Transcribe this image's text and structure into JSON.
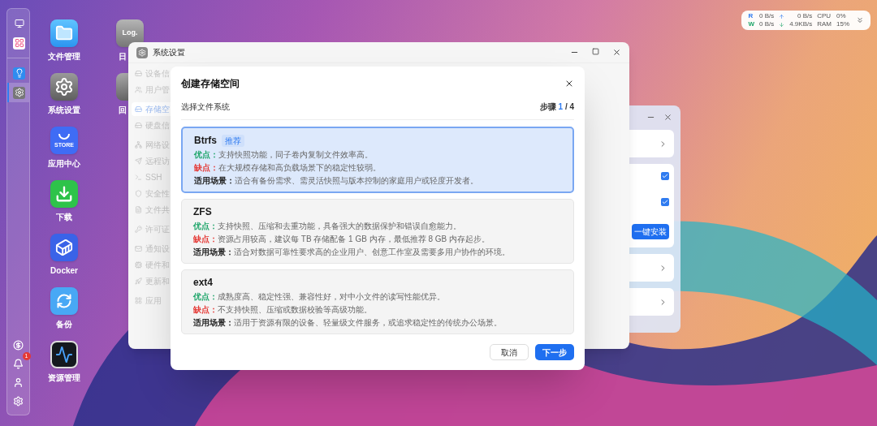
{
  "status_widget": {
    "rows": [
      {
        "label": "R",
        "disk": "0 B/s",
        "kind": "upload",
        "net": "0 B/s",
        "metric": "CPU",
        "value": "0%"
      },
      {
        "label": "W",
        "disk": "0 B/s",
        "kind": "download",
        "net": "4.9KB/s",
        "metric": "RAM",
        "value": "15%"
      }
    ]
  },
  "dock": {
    "items": [
      {
        "kind": "monitor",
        "selected": false
      },
      {
        "kind": "apps",
        "selected": false
      },
      {
        "kind": "bulb",
        "selected": false
      },
      {
        "kind": "settings",
        "selected": true
      }
    ],
    "bottom": [
      {
        "kind": "coin"
      },
      {
        "kind": "bell",
        "badge": "1"
      },
      {
        "kind": "user"
      },
      {
        "kind": "gear"
      }
    ]
  },
  "desktop_icons": [
    {
      "kind": "folder",
      "label": "文件管理"
    },
    {
      "kind": "settings",
      "label": "系统设置"
    },
    {
      "kind": "store",
      "label": "应用中心",
      "icon_text": "STORE"
    },
    {
      "kind": "download",
      "label": "下载"
    },
    {
      "kind": "docker",
      "label": "Docker"
    },
    {
      "kind": "backup",
      "label": "备份"
    },
    {
      "kind": "monitor",
      "label": "资源管理"
    }
  ],
  "desktop_icons_2": [
    {
      "kind": "log",
      "label": "日",
      "icon_text": "Log."
    },
    {
      "kind": "trash",
      "label": "回"
    }
  ],
  "settings_window": {
    "title": "系统设置",
    "sidebar_groups": [
      [
        {
          "label": "设备信",
          "selected": false
        },
        {
          "label": "用户管",
          "selected": false
        }
      ],
      [
        {
          "label": "存储空",
          "selected": true
        },
        {
          "label": "硬盘信",
          "selected": false
        }
      ],
      [
        {
          "label": "网络设",
          "selected": false
        },
        {
          "label": "远程访",
          "selected": false
        },
        {
          "label": "SSH",
          "selected": false
        },
        {
          "label": "安全性",
          "selected": false
        },
        {
          "label": "文件共",
          "selected": false
        }
      ],
      [
        {
          "label": "许可证",
          "selected": false
        }
      ],
      [
        {
          "label": "通知设",
          "selected": false
        },
        {
          "label": "硬件和",
          "selected": false
        },
        {
          "label": "更新和",
          "selected": false
        }
      ],
      [
        {
          "label": "应用",
          "selected": false
        }
      ]
    ]
  },
  "dialog": {
    "title": "创建存储空间",
    "subtitle": "选择文件系统",
    "step_label": "步骤",
    "step_current": "1",
    "step_total": "/ 4",
    "options": [
      {
        "name": "Btrfs",
        "badge": "推荐",
        "selected": true,
        "pros_label": "优点：",
        "pros": "支持快照功能，同子卷内复制文件效率高。",
        "cons_label": "缺点：",
        "cons": "在大规模存储和高负载场景下的稳定性较弱。",
        "use_label": "适用场景：",
        "use": "适合有备份需求、需灵活快照与版本控制的家庭用户或轻度开发者。"
      },
      {
        "name": "ZFS",
        "selected": false,
        "pros_label": "优点：",
        "pros": "支持快照、压缩和去重功能，具备强大的数据保护和错误自愈能力。",
        "cons_label": "缺点：",
        "cons": "资源占用较高，建议每 TB 存储配备 1 GB 内存，最低推荐 8 GB 内存起步。",
        "use_label": "适用场景：",
        "use": "适合对数据可靠性要求高的企业用户、创意工作室及需要多用户协作的环境。"
      },
      {
        "name": "ext4",
        "selected": false,
        "pros_label": "优点：",
        "pros": "成熟度高、稳定性强、兼容性好，对中小文件的读写性能优异。",
        "cons_label": "缺点：",
        "cons": "不支持快照、压缩或数据校验等高级功能。",
        "use_label": "适用场景：",
        "use": "适用于资源有限的设备、轻量级文件服务，或追求稳定性的传统办公场景。"
      }
    ],
    "cancel": "取消",
    "next": "下一步"
  },
  "side_window": {
    "cards": [
      {
        "kind": "link"
      },
      {
        "kind": "checks",
        "checks": [
          {
            "checked": true
          },
          {
            "checked": true
          }
        ],
        "button": "一键安装"
      },
      {
        "kind": "link"
      },
      {
        "kind": "link"
      }
    ]
  }
}
